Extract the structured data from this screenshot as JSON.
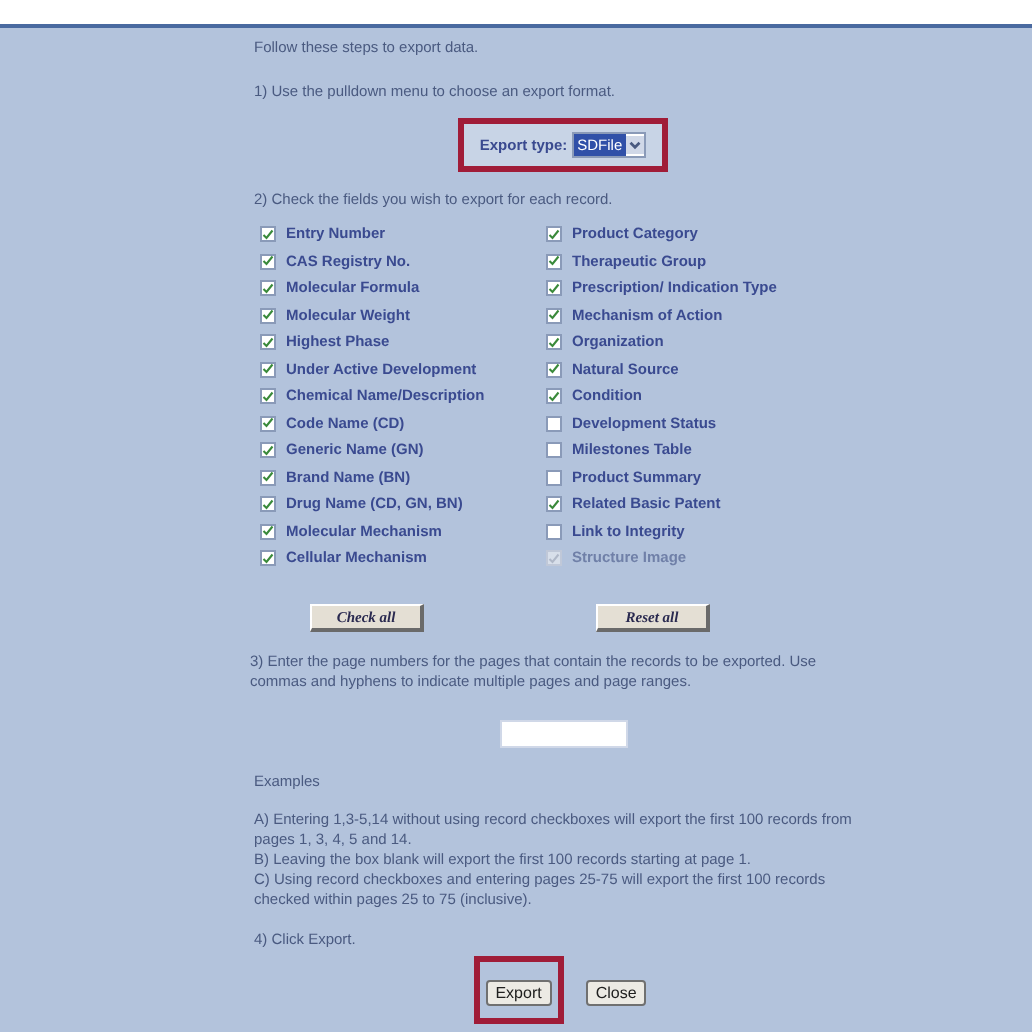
{
  "intro": "Follow these steps to export data.",
  "step1": "1) Use the pulldown menu to choose an export format.",
  "export_type": {
    "label": "Export type:",
    "value": "SDFile",
    "highlighted": true
  },
  "step2": "2) Check the fields you wish to export for each record.",
  "fields": [
    {
      "label": "Entry Number",
      "checked": true,
      "disabled": false
    },
    {
      "label": "Product Category",
      "checked": true,
      "disabled": false
    },
    {
      "label": "CAS Registry No.",
      "checked": true,
      "disabled": false
    },
    {
      "label": "Therapeutic Group",
      "checked": true,
      "disabled": false
    },
    {
      "label": "Molecular Formula",
      "checked": true,
      "disabled": false
    },
    {
      "label": "Prescription/ Indication Type",
      "checked": true,
      "disabled": false
    },
    {
      "label": "Molecular Weight",
      "checked": true,
      "disabled": false
    },
    {
      "label": "Mechanism of Action",
      "checked": true,
      "disabled": false
    },
    {
      "label": "Highest Phase",
      "checked": true,
      "disabled": false
    },
    {
      "label": "Organization",
      "checked": true,
      "disabled": false
    },
    {
      "label": "Under Active Development",
      "checked": true,
      "disabled": false
    },
    {
      "label": "Natural Source",
      "checked": true,
      "disabled": false
    },
    {
      "label": "Chemical Name/Description",
      "checked": true,
      "disabled": false
    },
    {
      "label": "Condition",
      "checked": true,
      "disabled": false
    },
    {
      "label": "Code Name (CD)",
      "checked": true,
      "disabled": false
    },
    {
      "label": "Development Status",
      "checked": false,
      "disabled": false
    },
    {
      "label": "Generic Name (GN)",
      "checked": true,
      "disabled": false
    },
    {
      "label": "Milestones Table",
      "checked": false,
      "disabled": false
    },
    {
      "label": "Brand Name (BN)",
      "checked": true,
      "disabled": false
    },
    {
      "label": "Product Summary",
      "checked": false,
      "disabled": false
    },
    {
      "label": "Drug Name (CD, GN, BN)",
      "checked": true,
      "disabled": false
    },
    {
      "label": "Related Basic Patent",
      "checked": true,
      "disabled": false
    },
    {
      "label": "Molecular Mechanism",
      "checked": true,
      "disabled": false
    },
    {
      "label": "Link to Integrity",
      "checked": false,
      "disabled": false
    },
    {
      "label": "Cellular Mechanism",
      "checked": true,
      "disabled": false
    },
    {
      "label": "Structure Image",
      "checked": true,
      "disabled": true
    }
  ],
  "check_buttons": [
    "Check all",
    "Reset all"
  ],
  "step3": "3) Enter the page numbers for the pages that contain the records to be exported. Use commas and hyphens to indicate multiple pages and page ranges.",
  "examples_heading": "Examples",
  "examples": [
    "A) Entering 1,3-5,14 without using record checkboxes will export the first 100 records from pages 1, 3, 4, 5 and 14.",
    "B) Leaving the box blank will export the first 100 records starting at page 1.",
    "C) Using record checkboxes and entering pages 25-75 will export the first 100 records checked within pages 25 to 75 (inclusive)."
  ],
  "step4": "4) Click Export.",
  "actions": [
    {
      "label": "Export",
      "highlighted": true
    },
    {
      "label": "Close",
      "highlighted": false
    }
  ]
}
